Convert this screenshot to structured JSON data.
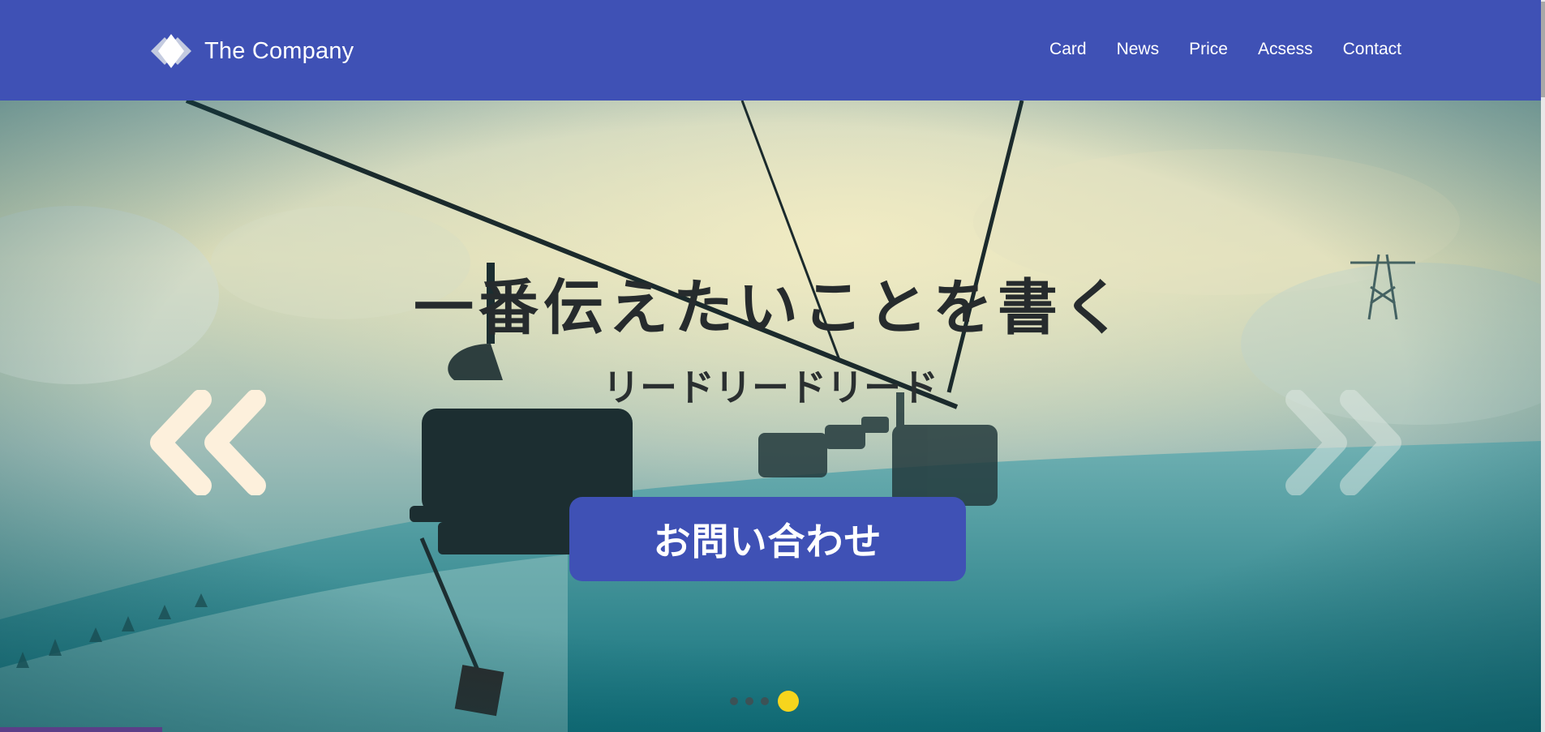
{
  "header": {
    "logo_text": "The Company",
    "nav": [
      "Card",
      "News",
      "Price",
      "Acsess",
      "Contact"
    ]
  },
  "hero": {
    "title": "一番伝えたいことを書く",
    "lead": "リードリードリード",
    "cta_label": "お問い合わせ",
    "slides_total": 4,
    "active_slide": 4
  },
  "colors": {
    "header_bg": "#3f51b5",
    "cta_bg": "#3f51b5",
    "active_dot": "#f7d51d",
    "arrow_left": "#fdf0dc"
  },
  "icons": {
    "logo": "diamond-logo-icon",
    "prev": "double-chevron-left-icon",
    "next": "double-chevron-right-icon"
  }
}
